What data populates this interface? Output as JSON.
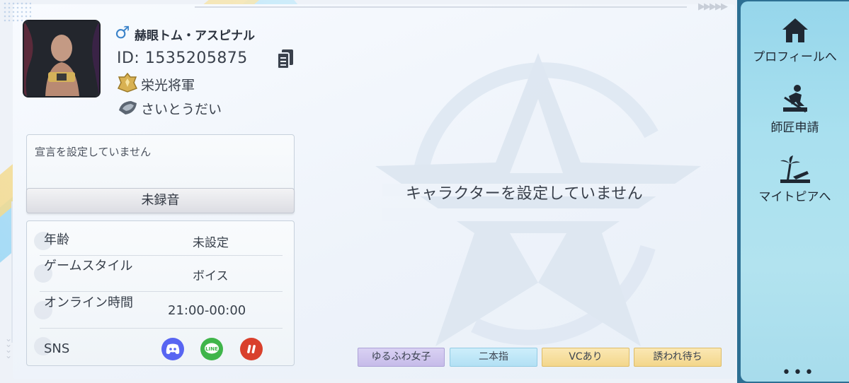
{
  "profile": {
    "gender_icon": "male-symbol",
    "name": "赫眼トム・アスピナル",
    "id_text": "ID: 1535205875",
    "rank": "栄光将軍",
    "title": "さいとうだい"
  },
  "declaration": {
    "text": "宣言を設定していません",
    "voice_button": "未録音"
  },
  "info": {
    "rows": [
      {
        "label": "年齢",
        "value": "未設定"
      },
      {
        "label": "ゲームスタイル",
        "value": "ボイス"
      },
      {
        "label": "オンライン時間",
        "value": "21:00-00:00"
      },
      {
        "label": "SNS",
        "value": ""
      }
    ],
    "sns_icons": [
      "discord-icon",
      "line-icon",
      "pause-brand-icon"
    ]
  },
  "character": {
    "empty_text": "キャラクターを設定していません"
  },
  "tags": [
    "ゆるふわ女子",
    "二本指",
    "VCあり",
    "誘われ待ち"
  ],
  "sidebar": {
    "items": [
      {
        "label": "プロフィールへ",
        "icon": "home-icon"
      },
      {
        "label": "師匠申請",
        "icon": "mentor-icon"
      },
      {
        "label": "マイトピアへ",
        "icon": "beach-icon"
      }
    ],
    "more": "•••"
  },
  "colors": {
    "sidebar": "#a9e0ef",
    "sidebar_border": "#2d6f93",
    "discord": "#5865f2",
    "line": "#3fb54a",
    "red_brand": "#d9402c"
  }
}
